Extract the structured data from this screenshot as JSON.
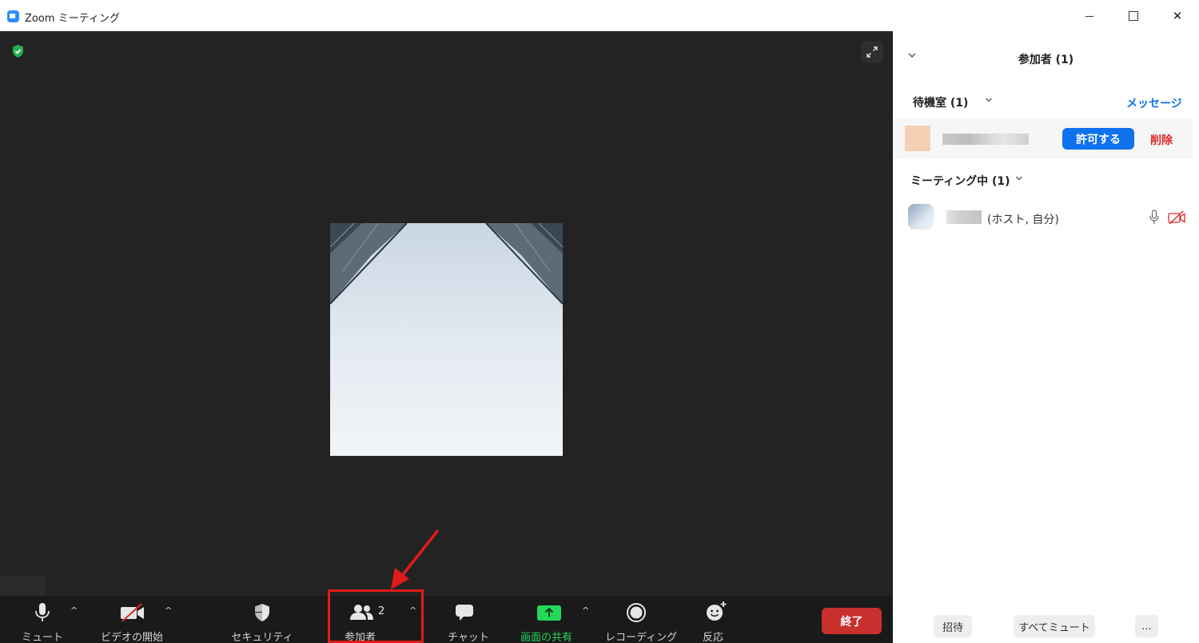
{
  "window": {
    "title": "Zoom ミーティング",
    "minimize_icon": "minimize-icon",
    "maximize_icon": "maximize-icon",
    "close_symbol": "✕"
  },
  "toolbar": {
    "mute_label": "ミュート",
    "video_label": "ビデオの開始",
    "security_label": "セキュリティ",
    "participants_label": "参加者",
    "participants_count": "2",
    "chat_label": "チャット",
    "share_label": "画面の共有",
    "record_label": "レコーディング",
    "reactions_label": "反応",
    "end_label": "終了",
    "caret": "^"
  },
  "panel": {
    "title": "参加者 (1)",
    "waiting_room": {
      "title": "待機室 (1)",
      "message_link": "メッセージ",
      "admit_button": "許可する",
      "remove_button": "削除"
    },
    "in_meeting": {
      "title": "ミーティング中 (1)",
      "host_suffix": "(ホスト, 自分)"
    },
    "footer": {
      "invite_label": "招待",
      "mute_all_label": "すべてミュート",
      "more_label": "..."
    }
  },
  "colors": {
    "accent_blue": "#0e72ed",
    "end_red": "#c7302d",
    "share_green": "#23d959",
    "annotation_red": "#e01b1b",
    "security_green": "#23b14d"
  }
}
